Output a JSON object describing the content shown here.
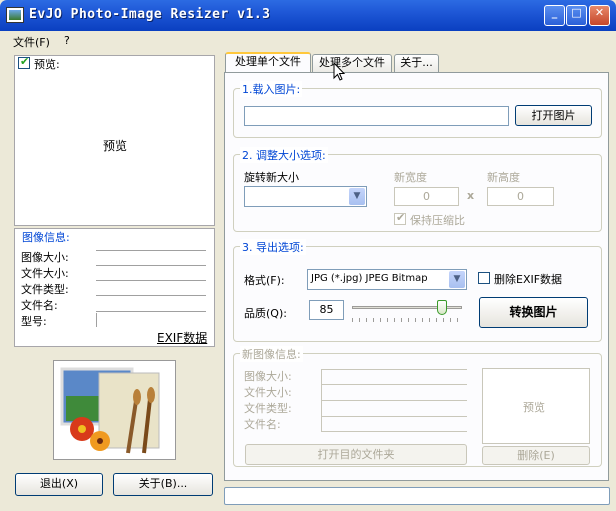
{
  "window": {
    "title": "EvJO Photo-Image Resizer v1.3",
    "minimize": "_",
    "maximize": "□",
    "close": "✕"
  },
  "menu": {
    "file": "文件(F)",
    "help": "?"
  },
  "left": {
    "preview_checkbox_label": "预览:",
    "preview_text": "预览",
    "image_info_title": "图像信息:",
    "info_labels": [
      "图像大小:",
      "文件大小:",
      "文件类型:",
      "文件名:",
      "型号:"
    ],
    "exif_link": "EXIF数据",
    "exit_button": "退出(X)",
    "about_button": "关于(B)..."
  },
  "tabs": [
    "处理单个文件",
    "处理多个文件",
    "关于..."
  ],
  "load": {
    "title": "1.载入图片:",
    "path_value": "",
    "open_button": "打开图片"
  },
  "resize": {
    "title": "2. 调整大小选项:",
    "rotate_label": "旋转新大小",
    "rotate_value": "",
    "new_width_label": "新宽度",
    "new_height_label": "新高度",
    "width_value": "0",
    "height_value": "0",
    "times": "x",
    "keep_ratio_label": "保持压缩比"
  },
  "export": {
    "title": "3. 导出选项:",
    "format_label": "格式(F):",
    "format_value": "JPG (*.jpg) JPEG Bitmap",
    "remove_exif_label": "删除EXIF数据",
    "quality_label": "品质(Q):",
    "quality_value": "85",
    "quality_level": 85,
    "convert_button": "转换图片"
  },
  "new_info": {
    "title": "新图像信息:",
    "labels": [
      "图像大小:",
      "文件大小:",
      "文件类型:",
      "文件名:"
    ],
    "preview_text": "预览",
    "open_folder_button": "打开目的文件夹",
    "delete_button": "删除(E)"
  },
  "colors": {
    "titlebar": "#0A3FC0",
    "group_label": "#0046d5",
    "tab_highlight": "#ffc83c"
  }
}
